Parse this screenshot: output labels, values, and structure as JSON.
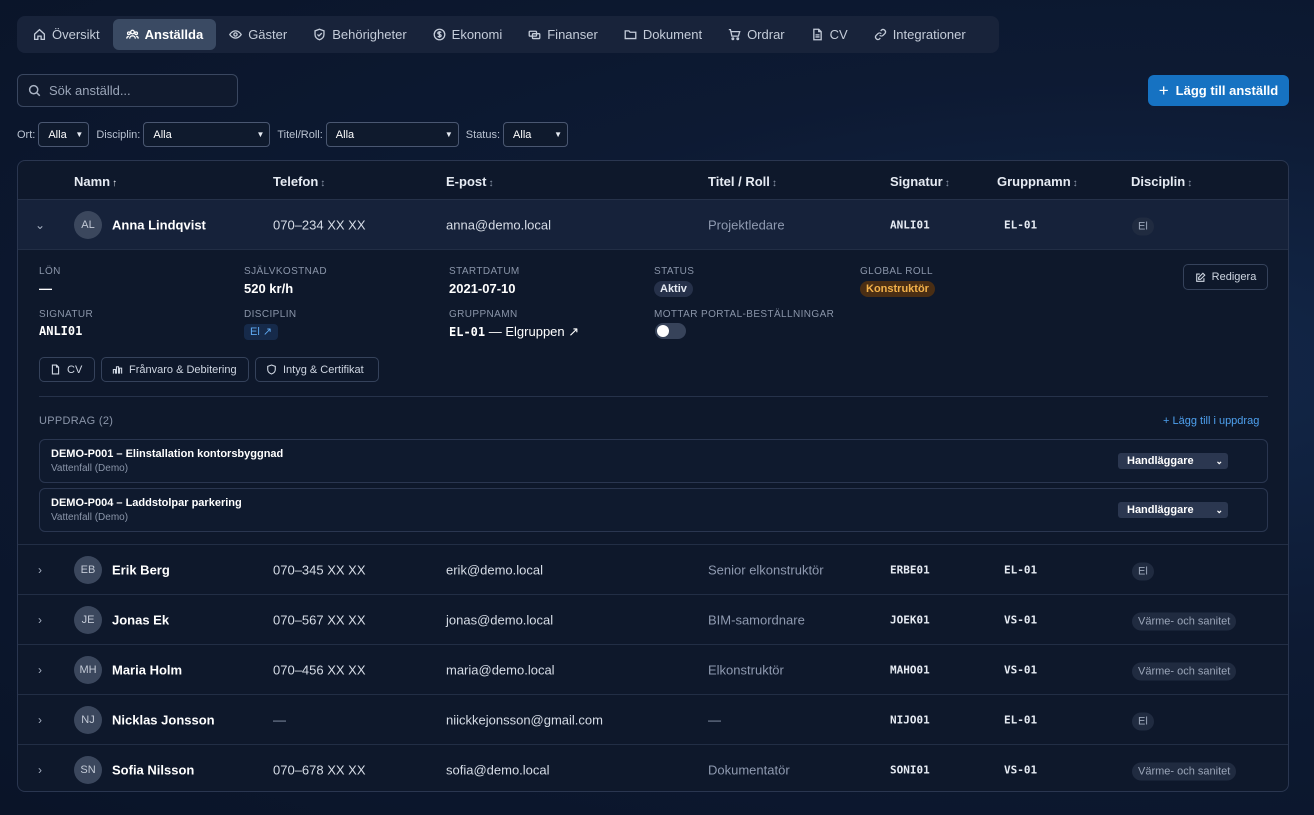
{
  "nav": {
    "tabs": [
      {
        "label": "Översikt",
        "icon": "home-icon"
      },
      {
        "label": "Anställda",
        "icon": "users-icon",
        "active": true
      },
      {
        "label": "Gäster",
        "icon": "eye-icon"
      },
      {
        "label": "Behörigheter",
        "icon": "shield-icon"
      },
      {
        "label": "Ekonomi",
        "icon": "dollar-circle-icon"
      },
      {
        "label": "Finanser",
        "icon": "coins-icon"
      },
      {
        "label": "Dokument",
        "icon": "folder-icon"
      },
      {
        "label": "Ordrar",
        "icon": "cart-icon"
      },
      {
        "label": "CV",
        "icon": "document-icon"
      },
      {
        "label": "Integrationer",
        "icon": "link-icon"
      }
    ]
  },
  "search": {
    "placeholder": "Sök anställd..."
  },
  "add_button": {
    "label": "Lägg till anställd"
  },
  "filters": {
    "ort": {
      "label": "Ort:",
      "value": "Alla"
    },
    "disciplin": {
      "label": "Disciplin:",
      "value": "Alla"
    },
    "titel": {
      "label": "Titel/Roll:",
      "value": "Alla"
    },
    "status": {
      "label": "Status:",
      "value": "Alla"
    }
  },
  "table": {
    "headers": {
      "name": "Namn",
      "phone": "Telefon",
      "email": "E-post",
      "title": "Titel / Roll",
      "signature": "Signatur",
      "group": "Gruppnamn",
      "discipline": "Disciplin"
    },
    "sort_asc_glyph": "↑",
    "sort_glyph": "↕",
    "rows": [
      {
        "initials": "AL",
        "name": "Anna Lindqvist",
        "phone": "070–234 XX XX",
        "email": "anna@demo.local",
        "title": "Projektledare",
        "signature": "ANLI01",
        "group": "EL-01",
        "discipline": "El",
        "expanded": true
      },
      {
        "initials": "EB",
        "name": "Erik Berg",
        "phone": "070–345 XX XX",
        "email": "erik@demo.local",
        "title": "Senior elkonstruktör",
        "signature": "ERBE01",
        "group": "EL-01",
        "discipline": "El"
      },
      {
        "initials": "JE",
        "name": "Jonas Ek",
        "phone": "070–567 XX XX",
        "email": "jonas@demo.local",
        "title": "BIM-samordnare",
        "signature": "JOEK01",
        "group": "VS-01",
        "discipline": "Värme- och sanitet"
      },
      {
        "initials": "MH",
        "name": "Maria Holm",
        "phone": "070–456 XX XX",
        "email": "maria@demo.local",
        "title": "Elkonstruktör",
        "signature": "MAHO01",
        "group": "VS-01",
        "discipline": "Värme- och sanitet"
      },
      {
        "initials": "NJ",
        "name": "Nicklas Jonsson",
        "phone": "—",
        "email": "niickkejonsson@gmail.com",
        "title": "—",
        "signature": "NIJO01",
        "group": "EL-01",
        "discipline": "El"
      },
      {
        "initials": "SN",
        "name": "Sofia Nilsson",
        "phone": "070–678 XX XX",
        "email": "sofia@demo.local",
        "title": "Dokumentatör",
        "signature": "SONI01",
        "group": "VS-01",
        "discipline": "Värme- och sanitet"
      }
    ]
  },
  "detail": {
    "salary_label": "Lön",
    "salary": "—",
    "cost_label": "Självkostnad",
    "cost": "520 kr/h",
    "start_label": "Startdatum",
    "start": "2021-07-10",
    "status_label": "Status",
    "status": "Aktiv",
    "global_role_label": "Global roll",
    "global_role": "Konstruktör",
    "signature_label": "Signatur",
    "signature": "ANLI01",
    "discipline_label": "Disciplin",
    "discipline": "El ↗",
    "group_label": "Gruppnamn",
    "group_code": "EL-01",
    "group_name": "— Elgruppen ↗",
    "portal_label": "Mottar portal-beställningar",
    "portal_enabled": false,
    "edit_label": "Redigera",
    "chips": {
      "cv": "CV",
      "absence": "Frånvaro & Debitering",
      "certs": "Intyg & Certifikat"
    },
    "assignments_label": "UPPDRAG (2)",
    "assignments_add": "+ Lägg till i uppdrag",
    "assignments": [
      {
        "title": "DEMO-P001 – Elinstallation kontorsbyggnad",
        "client": "Vattenfall (Demo)",
        "role": "Handläggare"
      },
      {
        "title": "DEMO-P004 – Laddstolpar parkering",
        "client": "Vattenfall (Demo)",
        "role": "Handläggare"
      }
    ]
  },
  "colors": {
    "accent": "#1672c2",
    "role_badge": "#f2b14a",
    "link": "#4ea0ee"
  }
}
